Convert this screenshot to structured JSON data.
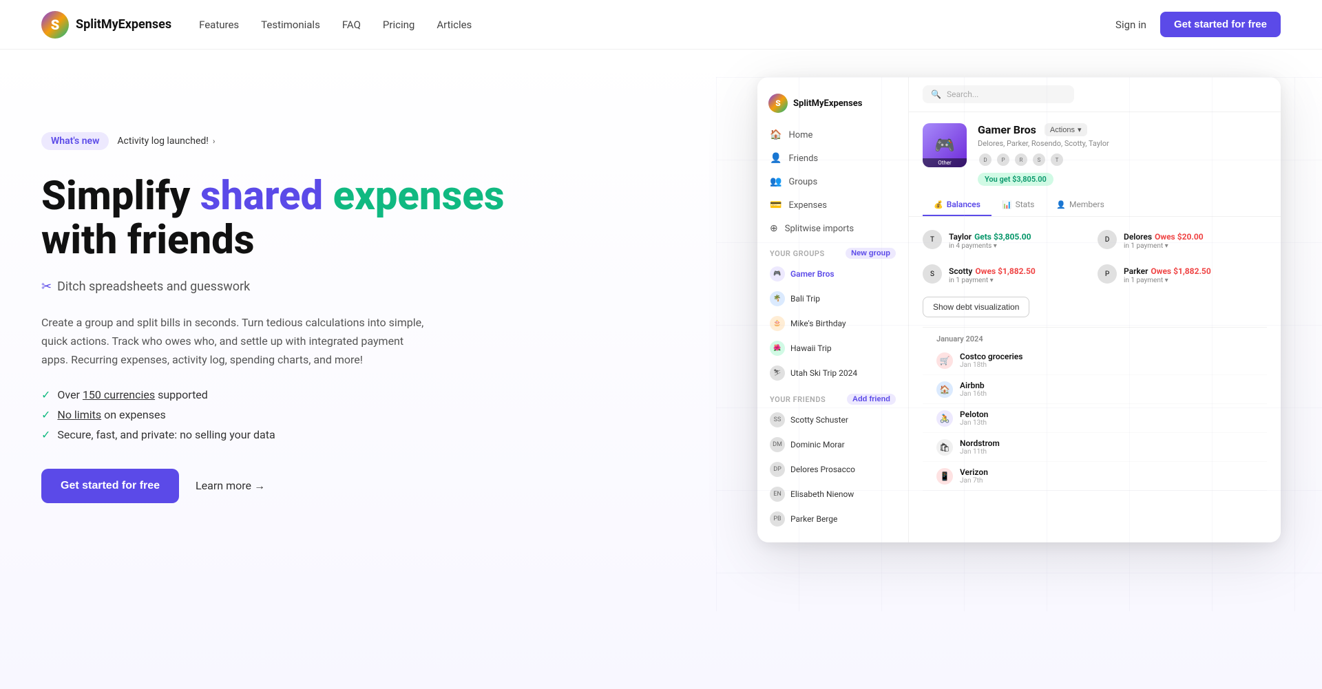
{
  "brand": {
    "logo_letter": "S",
    "name": "SplitMyExpenses"
  },
  "navbar": {
    "links": [
      "Features",
      "Testimonials",
      "FAQ",
      "Pricing",
      "Articles"
    ],
    "signin": "Sign in",
    "cta": "Get started for free"
  },
  "hero": {
    "badge": "What's new",
    "badge_link": "Activity log launched!",
    "headline_part1": "Simplify ",
    "headline_shared": "shared",
    "headline_part2": " ",
    "headline_expenses": "expenses",
    "headline_part3": "\nwith friends",
    "subheading": "Ditch spreadsheets and guesswork",
    "description": "Create a group and split bills in seconds. Turn tedious calculations into simple, quick actions. Track who owes who, and settle up with integrated payment apps. Recurring expenses, activity log, spending charts, and more!",
    "features": [
      {
        "text": "Over ",
        "link": "150 currencies",
        "link_suffix": " supported"
      },
      {
        "text": "",
        "link": "No limits",
        "link_suffix": " on expenses"
      },
      {
        "text": "Secure, fast, and private: no selling your data",
        "link": null
      }
    ],
    "cta_primary": "Get started for free",
    "cta_secondary": "Learn more →"
  },
  "app": {
    "brand_name": "SplitMyExpenses",
    "search_placeholder": "Search...",
    "nav_items": [
      {
        "label": "Home",
        "icon": "🏠"
      },
      {
        "label": "Friends",
        "icon": "👤"
      },
      {
        "label": "Groups",
        "icon": "👥"
      },
      {
        "label": "Expenses",
        "icon": "💳"
      },
      {
        "label": "Splitwise imports",
        "icon": "⊕"
      }
    ],
    "groups_label": "Your groups",
    "new_group_btn": "New group",
    "groups": [
      {
        "name": "Gamer Bros",
        "color": "purple",
        "active": true
      },
      {
        "name": "Bali Trip",
        "color": "blue"
      },
      {
        "name": "Mike's Birthday",
        "color": "orange"
      },
      {
        "name": "Hawaii Trip",
        "color": "green"
      },
      {
        "name": "Utah Ski Trip 2024",
        "color": "gray"
      }
    ],
    "friends_label": "Your friends",
    "add_friend_btn": "Add friend",
    "friends": [
      {
        "name": "Scotty Schuster"
      },
      {
        "name": "Dominic Morar"
      },
      {
        "name": "Delores Prosacco"
      },
      {
        "name": "Elisabeth Nienow"
      },
      {
        "name": "Parker Berge"
      }
    ],
    "group_detail": {
      "name": "Gamer Bros",
      "actions_label": "Actions",
      "members_text": "Delores, Parker, Rosendo, Scotty, Taylor",
      "you_get_badge": "You get $3,805.00",
      "other_label": "Other",
      "tabs": [
        "Balances",
        "Stats",
        "Members"
      ],
      "active_tab": "Balances",
      "balances": [
        {
          "name": "Taylor",
          "status": "Gets",
          "amount": "$3,805.00",
          "type": "green",
          "detail": "in 4 payments"
        },
        {
          "name": "Delores",
          "status": "Owes",
          "amount": "$20.00",
          "type": "red",
          "detail": "in 1 payment"
        },
        {
          "name": "Scotty",
          "status": "Owes",
          "amount": "$1,882.50",
          "type": "red",
          "detail": "in 1 payment"
        },
        {
          "name": "Parker",
          "status": "Owes",
          "amount": "$1,882.50",
          "type": "red",
          "detail": "in 1 payment"
        }
      ],
      "show_debt_btn": "Show debt visualization",
      "month_label": "January 2024",
      "expenses": [
        {
          "name": "Costco groceries",
          "date": "Jan 18th",
          "icon_color": "red",
          "icon": "🛒"
        },
        {
          "name": "Airbnb",
          "date": "Jan 16th",
          "icon_color": "blue",
          "icon": "🏠"
        },
        {
          "name": "Peloton",
          "date": "Jan 13th",
          "icon_color": "purple",
          "icon": "🚴"
        },
        {
          "name": "Nordstrom",
          "date": "Jan 11th",
          "icon_color": "gray",
          "icon": "🛍"
        },
        {
          "name": "Verizon",
          "date": "Jan 7th",
          "icon_color": "red",
          "icon": "📱"
        }
      ]
    }
  }
}
